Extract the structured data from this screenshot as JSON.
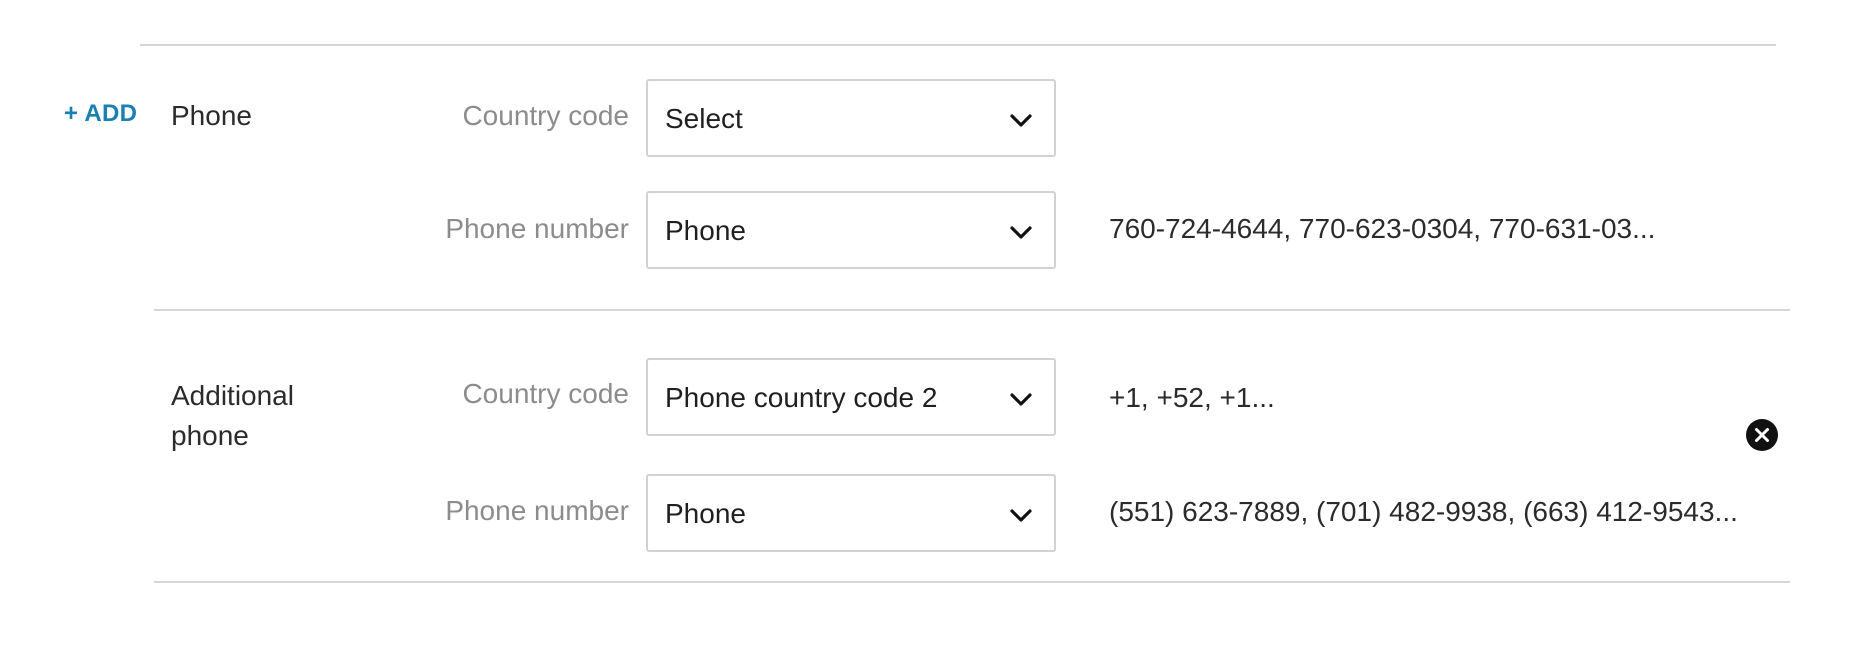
{
  "add_link": {
    "label": "+ ADD"
  },
  "sections": [
    {
      "title": "Phone",
      "fields": [
        {
          "label": "Country code",
          "select_value": "Select",
          "preview": ""
        },
        {
          "label": "Phone number",
          "select_value": "Phone",
          "preview": "760-724-4644, 770-623-0304, 770-631-03..."
        }
      ]
    },
    {
      "title": "Additional phone",
      "fields": [
        {
          "label": "Country code",
          "select_value": "Phone country code 2",
          "preview": "+1, +52, +1..."
        },
        {
          "label": "Phone number",
          "select_value": "Phone",
          "preview": "(551) 623-7889, (701) 482-9938, (663) 412-9543..."
        }
      ],
      "remove_icon": "close-circle-icon"
    }
  ],
  "colors": {
    "accent": "#1a7fb3",
    "label_gray": "#8c8c8c",
    "divider": "#d6d6d6",
    "border": "#d2d2d2"
  }
}
